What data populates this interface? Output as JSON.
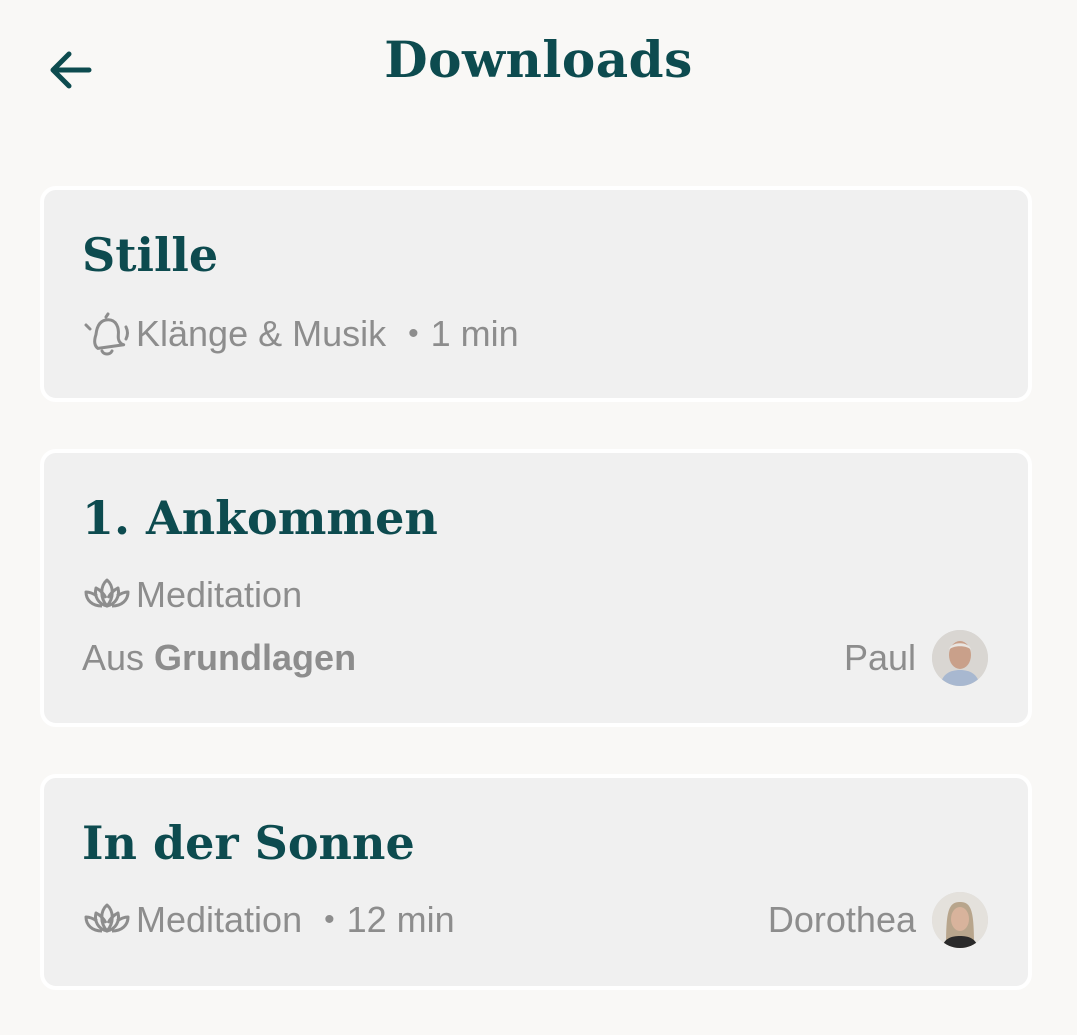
{
  "header": {
    "title": "Downloads",
    "back_icon": "arrow-left-icon"
  },
  "colors": {
    "accent": "#0d4b4f",
    "muted_text": "#8d8d8d",
    "card_bg": "#f0f0f0",
    "page_bg": "#f9f8f6"
  },
  "downloads": [
    {
      "title": "Stille",
      "category": "Klänge & Musik",
      "category_icon": "bell-icon",
      "separator": "•",
      "duration": "1 min"
    },
    {
      "title": "1. Ankommen",
      "category": "Meditation",
      "category_icon": "lotus-icon",
      "from_prefix": "Aus",
      "from_course": "Grundlagen",
      "teacher": "Paul"
    },
    {
      "title": "In der Sonne",
      "category": "Meditation",
      "category_icon": "lotus-icon",
      "separator": "•",
      "duration": "12 min",
      "teacher": "Dorothea"
    }
  ]
}
